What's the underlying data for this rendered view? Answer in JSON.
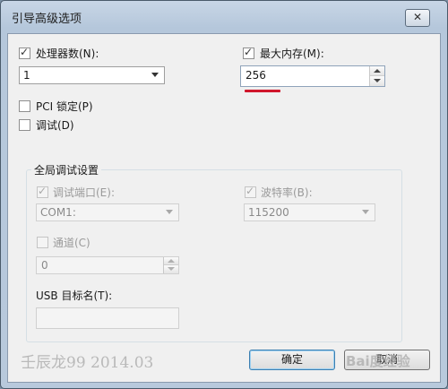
{
  "window": {
    "title": "引导高级选项",
    "close_glyph": "✕"
  },
  "processors": {
    "label": "处理器数(N):",
    "checked": true,
    "value": "1"
  },
  "max_memory": {
    "label": "最大内存(M):",
    "checked": true,
    "value": "256"
  },
  "pci_lock": {
    "label": "PCI 锁定(P)",
    "checked": false
  },
  "debug": {
    "label": "调试(D)",
    "checked": false
  },
  "global_debug": {
    "title": "全局调试设置",
    "debug_port": {
      "label": "调试端口(E):",
      "checked": true,
      "value": "COM1:"
    },
    "baud_rate": {
      "label": "波特率(B):",
      "checked": true,
      "value": "115200"
    },
    "channel": {
      "label": "通道(C)",
      "checked": false,
      "value": "0"
    },
    "usb_target": {
      "label": "USB 目标名(T):",
      "value": ""
    }
  },
  "buttons": {
    "ok": "确定",
    "cancel": "取消"
  },
  "watermark": "壬辰龙99  2014.03",
  "baidu_watermark": "Bai度经验",
  "colors": {
    "accent_underline": "#d0162c",
    "title_bar": "#c8d6e6"
  }
}
